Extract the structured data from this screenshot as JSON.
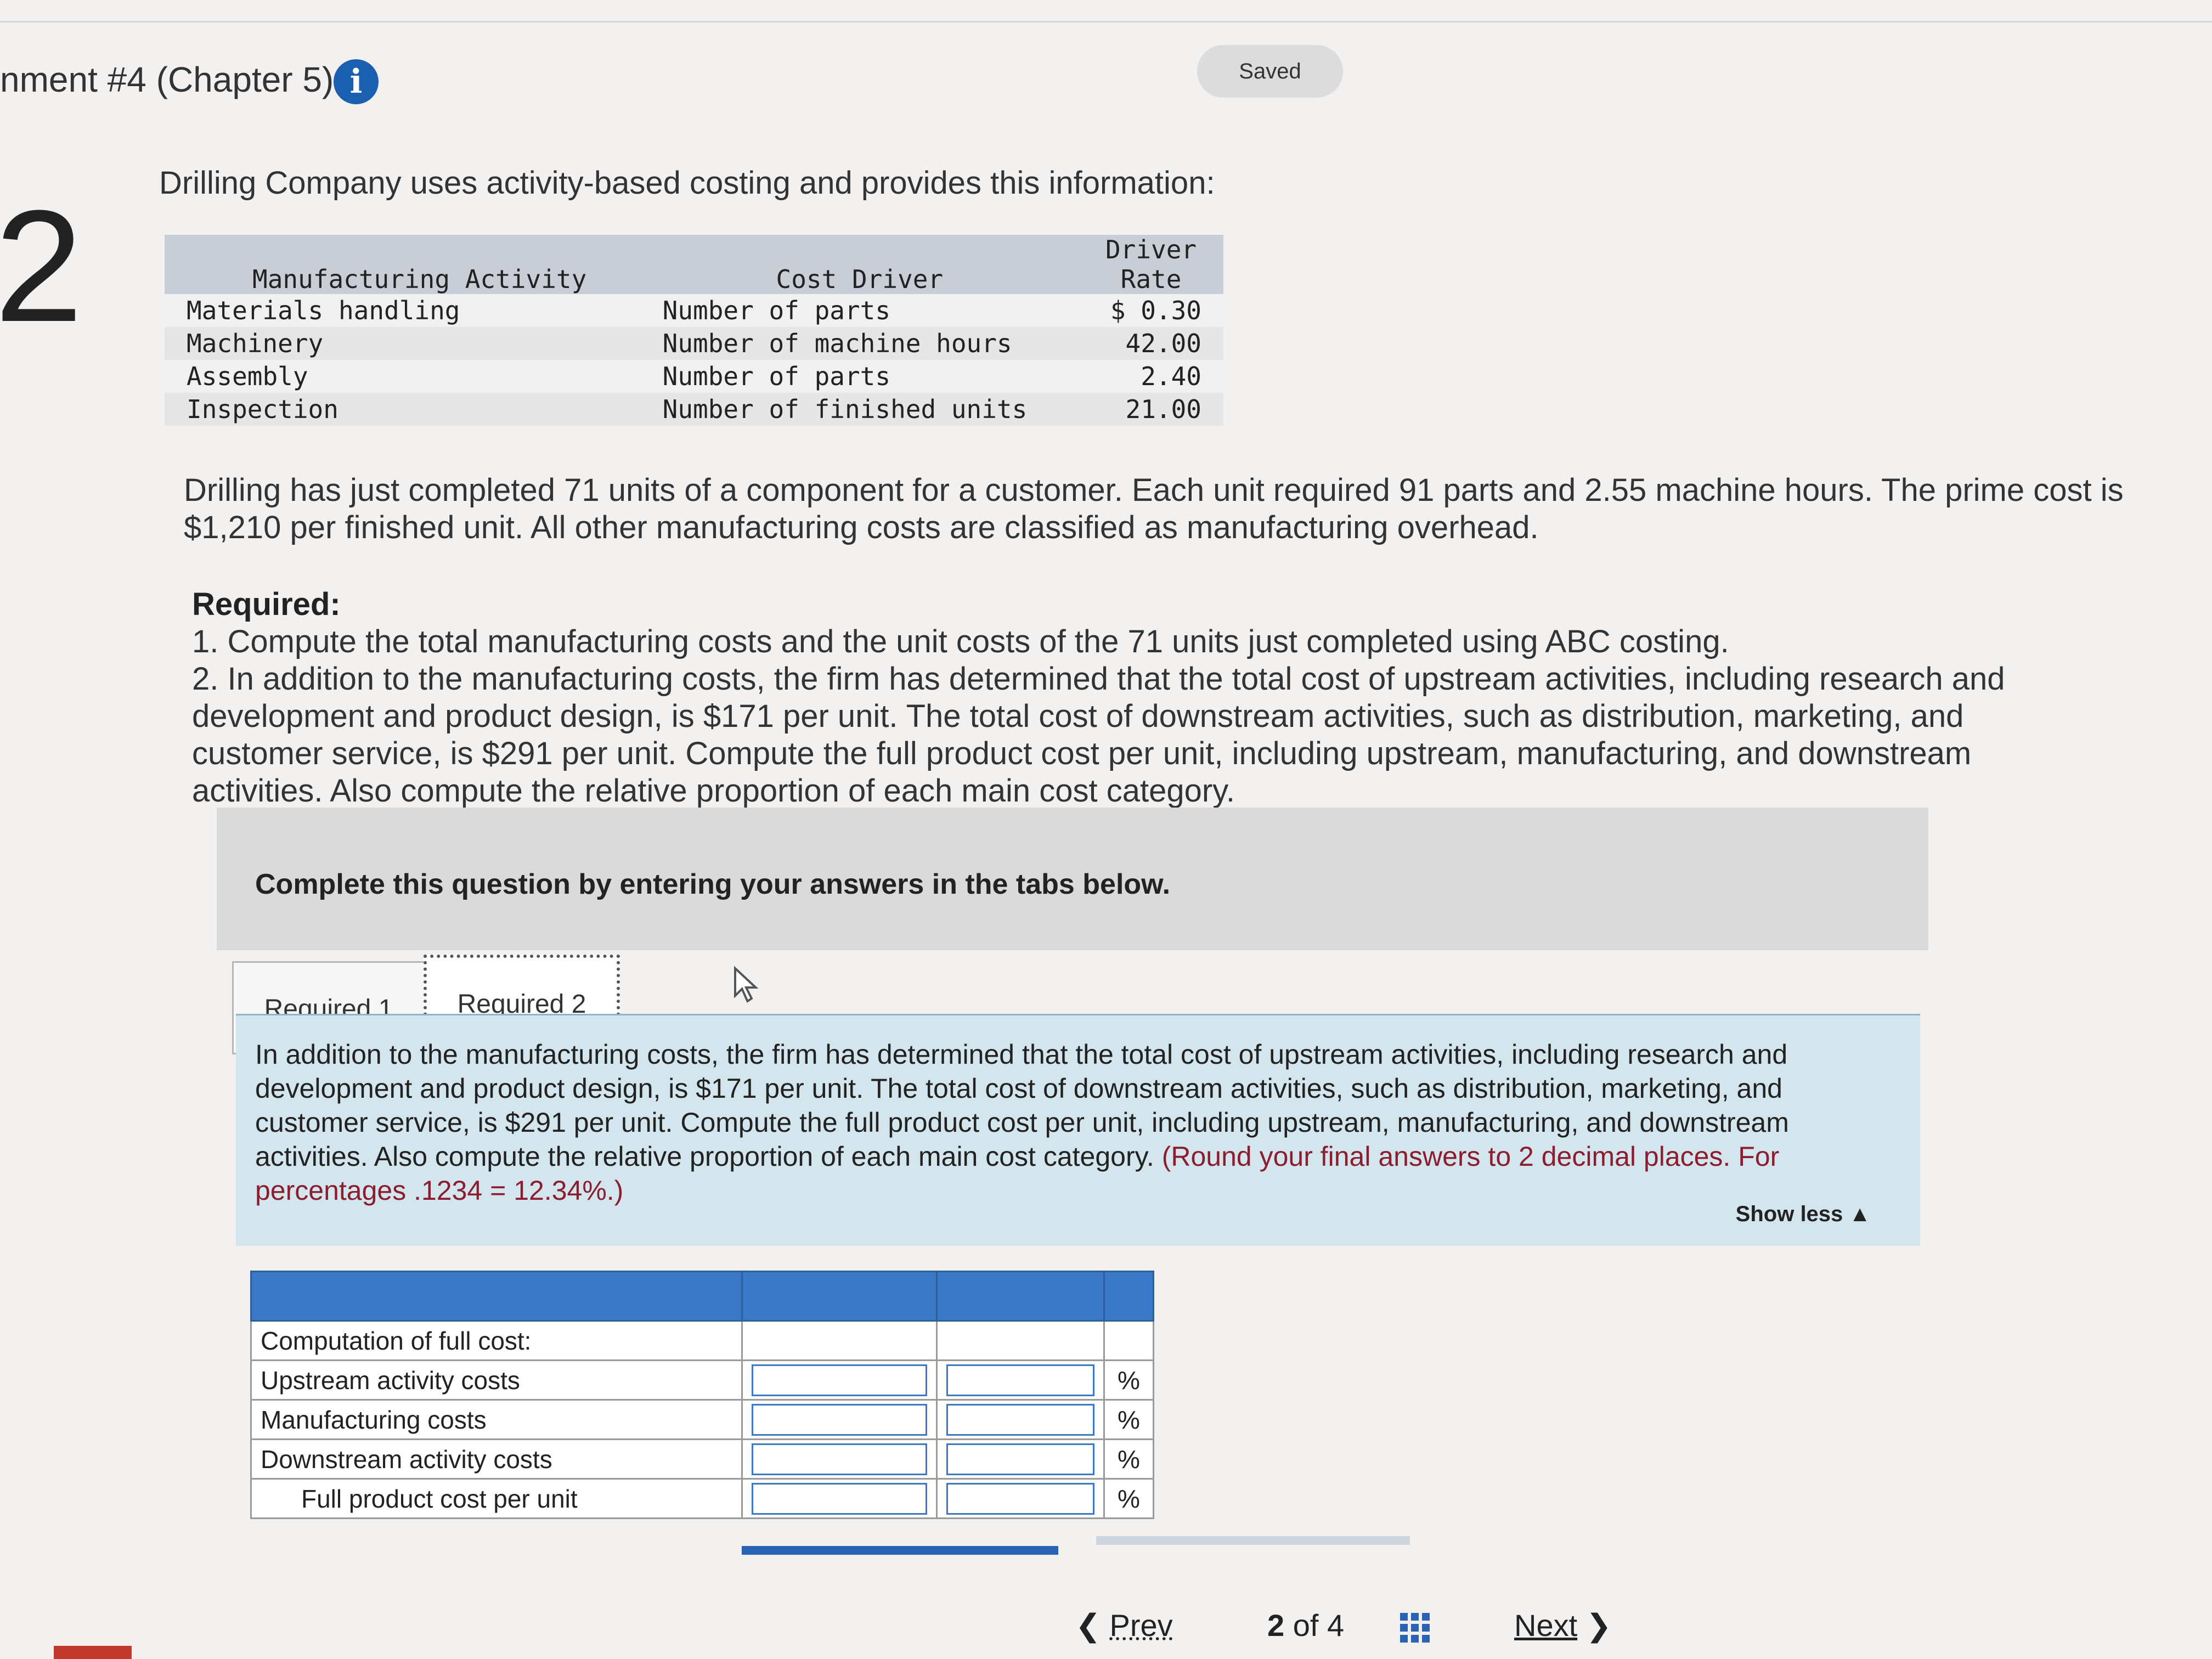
{
  "header": {
    "title": "nment #4 (Chapter 5)",
    "info_icon": "i",
    "saved_label": "Saved",
    "question_number": "2"
  },
  "intro": "Drilling Company uses activity-based costing and provides this information:",
  "activity_table": {
    "headers": {
      "activity": "Manufacturing Activity",
      "driver": "Cost Driver",
      "rate_line1": "Driver",
      "rate_line2": "Rate"
    },
    "rows": [
      {
        "activity": "Materials handling",
        "driver": "Number of parts",
        "rate": "$ 0.30"
      },
      {
        "activity": "Machinery",
        "driver": "Number of machine hours",
        "rate": "42.00"
      },
      {
        "activity": "Assembly",
        "driver": "Number of parts",
        "rate": "2.40"
      },
      {
        "activity": "Inspection",
        "driver": "Number of finished units",
        "rate": "21.00"
      }
    ]
  },
  "scenario": "Drilling has just completed 71 units of a component for a customer. Each unit required 91 parts and 2.55 machine hours. The prime cost is $1,210 per finished unit. All other manufacturing costs are classified as manufacturing overhead.",
  "required": {
    "title": "Required:",
    "items": [
      "1. Compute the total manufacturing costs and the unit costs of the 71 units just completed using ABC costing.",
      "2. In addition to the manufacturing costs, the firm has determined that the total cost of upstream activities, including research and development and product design, is $171 per unit. The total cost of downstream activities, such as distribution, marketing, and customer service, is $291 per unit. Compute the full product cost per unit, including upstream, manufacturing, and downstream activities. Also compute the relative proportion of each main cost category."
    ]
  },
  "instruction": "Complete this question by entering your answers in the tabs below.",
  "tabs": [
    {
      "label": "Required 1",
      "active": false
    },
    {
      "label": "Required 2",
      "active": true
    }
  ],
  "panel": {
    "text": "In addition to the manufacturing costs, the firm has determined that the total cost of upstream activities, including research and development and product design, is $171 per unit. The total cost of downstream activities, such as distribution, marketing, and customer service, is $291 per unit. Compute the full product cost per unit, including upstream, manufacturing, and downstream activities. Also compute the relative proportion of each main cost category.",
    "note": "(Round your final answers to 2 decimal places. For percentages .1234 = 12.34%.)",
    "show_less": "Show less ▲"
  },
  "answer_table": {
    "rows": [
      {
        "label": "Computation of full cost:",
        "inputs": false,
        "pct": ""
      },
      {
        "label": "Upstream activity costs",
        "inputs": true,
        "pct": "%"
      },
      {
        "label": "Manufacturing costs",
        "inputs": true,
        "pct": "%"
      },
      {
        "label": "Downstream activity costs",
        "inputs": true,
        "pct": "%"
      },
      {
        "label": "Full product cost per unit",
        "inputs": true,
        "pct": "%"
      }
    ]
  },
  "footer": {
    "prev_label": "Prev",
    "page_current": "2",
    "page_of": "of 4",
    "next_label": "Next"
  },
  "colors": {
    "accent_blue": "#3b78c6",
    "panel_bg": "#d3e5ed",
    "note_red": "#8c1d2f"
  }
}
